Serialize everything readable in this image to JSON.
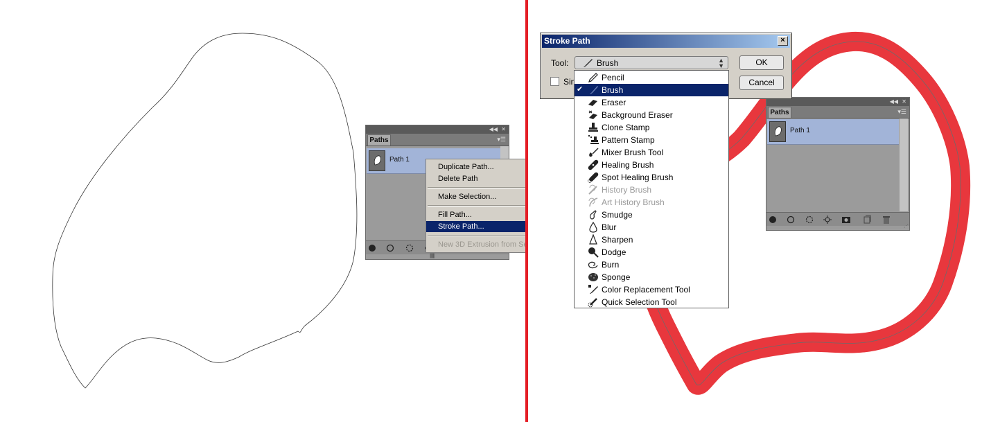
{
  "left_panel": {
    "tab": "Paths",
    "path_name": "Path 1",
    "collapse_icon": "double-chevron-left-icon",
    "menu_icon": "panel-menu-icon"
  },
  "context_menu": {
    "items": [
      {
        "label": "Duplicate Path...",
        "state": "normal"
      },
      {
        "label": "Delete Path",
        "state": "normal"
      },
      {
        "label": "Make Selection...",
        "state": "normal"
      },
      {
        "label": "Fill Path...",
        "state": "normal"
      },
      {
        "label": "Stroke Path...",
        "state": "selected"
      },
      {
        "label": "New 3D Extrusion from Se",
        "state": "disabled"
      }
    ]
  },
  "dialog": {
    "title": "Stroke Path",
    "tool_label": "Tool:",
    "tool_value": "Brush",
    "checkbox_label_partial": "Sin",
    "ok_label": "OK",
    "cancel_label": "Cancel"
  },
  "tool_dropdown": {
    "items": [
      {
        "label": "Pencil",
        "icon": "pencil-icon",
        "state": "normal"
      },
      {
        "label": "Brush",
        "icon": "brush-icon",
        "state": "selected"
      },
      {
        "label": "Eraser",
        "icon": "eraser-icon",
        "state": "normal"
      },
      {
        "label": "Background Eraser",
        "icon": "background-eraser-icon",
        "state": "normal"
      },
      {
        "label": "Clone Stamp",
        "icon": "clone-stamp-icon",
        "state": "normal"
      },
      {
        "label": "Pattern Stamp",
        "icon": "pattern-stamp-icon",
        "state": "normal"
      },
      {
        "label": "Mixer Brush Tool",
        "icon": "mixer-brush-icon",
        "state": "normal"
      },
      {
        "label": "Healing Brush",
        "icon": "healing-brush-icon",
        "state": "normal"
      },
      {
        "label": "Spot Healing Brush",
        "icon": "spot-healing-brush-icon",
        "state": "normal"
      },
      {
        "label": "History Brush",
        "icon": "history-brush-icon",
        "state": "disabled"
      },
      {
        "label": "Art History Brush",
        "icon": "art-history-brush-icon",
        "state": "disabled"
      },
      {
        "label": "Smudge",
        "icon": "smudge-icon",
        "state": "normal"
      },
      {
        "label": "Blur",
        "icon": "blur-icon",
        "state": "normal"
      },
      {
        "label": "Sharpen",
        "icon": "sharpen-icon",
        "state": "normal"
      },
      {
        "label": "Dodge",
        "icon": "dodge-icon",
        "state": "normal"
      },
      {
        "label": "Burn",
        "icon": "burn-icon",
        "state": "normal"
      },
      {
        "label": "Sponge",
        "icon": "sponge-icon",
        "state": "normal"
      },
      {
        "label": "Color Replacement Tool",
        "icon": "color-replacement-icon",
        "state": "normal"
      },
      {
        "label": "Quick Selection Tool",
        "icon": "quick-selection-icon",
        "state": "normal"
      }
    ]
  },
  "right_panel": {
    "tab": "Paths",
    "path_name": "Path 1"
  },
  "colors": {
    "divider": "#e41e26",
    "stroke": "#e8373d",
    "menu_highlight": "#0a246a",
    "path_row": "#a2b4d8"
  }
}
